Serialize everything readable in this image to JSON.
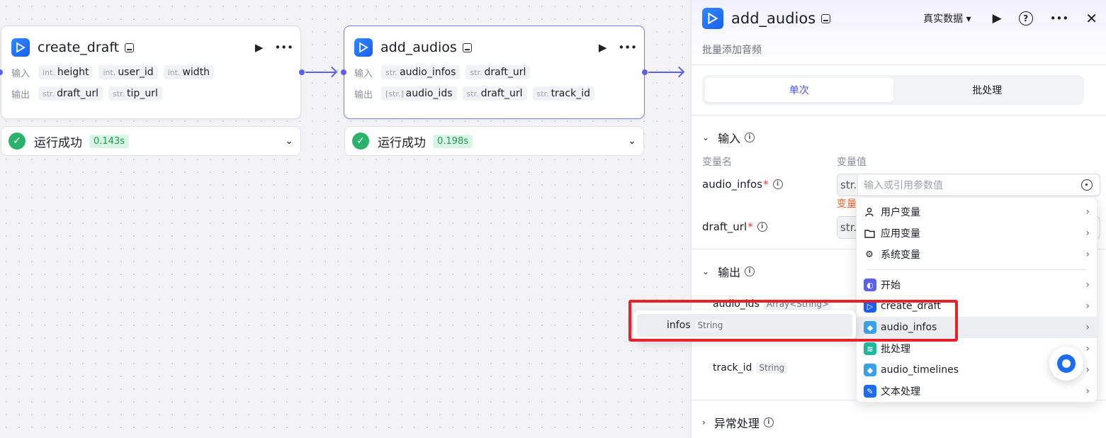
{
  "nodes": [
    {
      "title": "create_draft",
      "input_label": "输入",
      "output_label": "输出",
      "inputs": [
        {
          "type": "int.",
          "name": "height"
        },
        {
          "type": "int.",
          "name": "user_id"
        },
        {
          "type": "int.",
          "name": "width"
        }
      ],
      "outputs": [
        {
          "type": "str.",
          "name": "draft_url"
        },
        {
          "type": "str.",
          "name": "tip_url"
        }
      ],
      "status": "运行成功",
      "time": "0.143s"
    },
    {
      "title": "add_audios",
      "input_label": "输入",
      "output_label": "输出",
      "inputs": [
        {
          "type": "str.",
          "name": "audio_infos"
        },
        {
          "type": "str.",
          "name": "draft_url"
        }
      ],
      "outputs": [
        {
          "type": "[str.]",
          "name": "audio_ids"
        },
        {
          "type": "str.",
          "name": "draft_url"
        },
        {
          "type": "str.",
          "name": "track_id"
        }
      ],
      "status": "运行成功",
      "time": "0.198s"
    }
  ],
  "panel": {
    "title": "add_audios",
    "data_dropdown": "真实数据 ▾",
    "description": "批量添加音频",
    "tabs": [
      "单次",
      "批处理"
    ],
    "input_section": "输入",
    "col_name": "变量名",
    "col_value": "变量值",
    "vars": [
      {
        "name": "audio_infos",
        "type": "str.",
        "placeholder": "输入或引用参数值"
      },
      {
        "name": "draft_url",
        "type": "str."
      }
    ],
    "error_text": "变量",
    "output_section": "输出",
    "outputs": [
      {
        "name": "audio_ids",
        "type": "Array<String>"
      },
      {
        "name": "track_id",
        "type": "String"
      }
    ],
    "exception_section": "异常处理"
  },
  "menu": {
    "items": [
      {
        "label": "用户变量",
        "icon": "user-icon"
      },
      {
        "label": "应用变量",
        "icon": "folder-icon"
      },
      {
        "label": "系统变量",
        "icon": "gear-icon"
      }
    ],
    "nodes": [
      {
        "label": "开始",
        "color": "#5b5fe9"
      },
      {
        "label": "create_draft",
        "color": "#1b5ef0"
      },
      {
        "label": "audio_infos",
        "color": "#3aa0e8"
      },
      {
        "label": "批处理",
        "color": "#1fb89a"
      },
      {
        "label": "audio_timelines",
        "color": "#3aa0e8"
      },
      {
        "label": "文本处理",
        "color": "#1d6bf0"
      }
    ]
  },
  "submenu": {
    "name": "infos",
    "type": "String"
  },
  "colors": {
    "accent": "#4d53e8",
    "success": "#2bb36c",
    "highlight": "#e8222b"
  }
}
